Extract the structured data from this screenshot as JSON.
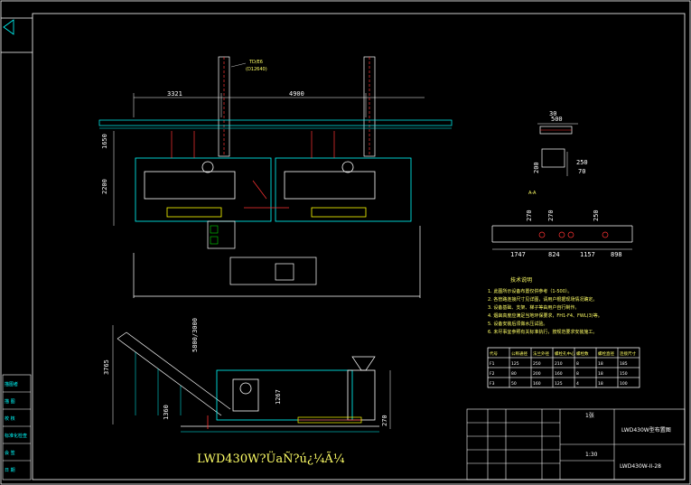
{
  "drawing": {
    "main_title": "LWD430W?ÜaÑ?ú¿¼Ã¼",
    "chimney_note": "TD/E6",
    "chimney_note2": "(D12640)",
    "top_dims": {
      "left": "3321",
      "right": "4900"
    },
    "left_dims": {
      "upper": "1650",
      "lower": "2200"
    },
    "right_view": {
      "dims_top": [
        "500",
        "30"
      ],
      "dims_side": [
        "200",
        "250",
        "70"
      ],
      "dims_row": [
        "1747",
        "824",
        "1157",
        "898"
      ],
      "dims_vert": [
        "270",
        "270",
        "250"
      ],
      "section_label": "A-A"
    },
    "elev_dims": {
      "upper_left": "5800/3000",
      "height": "3765",
      "mid": "1360",
      "small": "270",
      "inner": "1267"
    },
    "notes_title": "技术说明",
    "notes": [
      "1. 此图所示设备布置仅供参考（1-500）。",
      "2. 各管路连接尺寸见详图，请用户根据现场情况确定。",
      "3. 设备基础、支架、梯子等由用户自行制作。",
      "4. 烟囱高度应满足当地环保要求，FH1-F4、FWL(3)等。",
      "5. 设备安装后须做水压试验。",
      "6. 未尽事宜参照有关标准执行，按规范要求安装施工。"
    ],
    "spec_table": {
      "headers": [
        "代号",
        "公称通径",
        "法兰外径",
        "螺栓孔中心",
        "螺栓数",
        "螺栓直径",
        "连接尺寸"
      ],
      "rows": [
        [
          "F1",
          "125",
          "250",
          "210",
          "8",
          "18",
          "185"
        ],
        [
          "F2",
          "80",
          "200",
          "160",
          "8",
          "18",
          "150"
        ],
        [
          "F3",
          "50",
          "160",
          "125",
          "4",
          "18",
          "100"
        ]
      ]
    },
    "title_block": {
      "project": "LWD430W型布置图",
      "code": "LWD430W-II-28",
      "scale": "1:30",
      "sheet": "1张"
    },
    "left_margin_labels": [
      "描图者",
      "描 图",
      "校 核",
      "标准化检查",
      "会 签",
      "日 期"
    ]
  }
}
